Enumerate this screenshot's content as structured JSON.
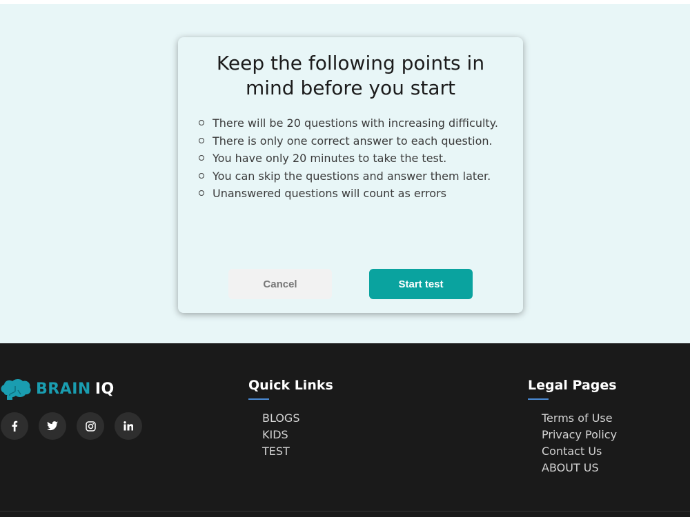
{
  "modal": {
    "title": "Keep the following points in mind before you start",
    "points": [
      "There will be 20 questions with increasing difficulty.",
      "There is only one correct answer to each question.",
      "You have only 20 minutes to take the test.",
      "You can skip the questions and answer them later.",
      "Unanswered questions will count as errors"
    ],
    "cancel_label": "Cancel",
    "start_label": "Start test"
  },
  "footer": {
    "logo_brain": "BRAIN",
    "logo_iq": "IQ",
    "socials": [
      {
        "icon": "facebook-icon",
        "glyph": "f"
      },
      {
        "icon": "twitter-icon",
        "glyph": "t"
      },
      {
        "icon": "instagram-icon",
        "glyph": "ig"
      },
      {
        "icon": "linkedin-icon",
        "glyph": "in"
      }
    ],
    "quick_links": {
      "title": "Quick Links",
      "items": [
        "BLOGS",
        "KIDS",
        "TEST"
      ]
    },
    "legal_pages": {
      "title": "Legal Pages",
      "items": [
        "Terms of Use",
        "Privacy Policy",
        "Contact Us",
        "ABOUT US"
      ]
    }
  },
  "colors": {
    "accent": "#0aa39f",
    "brand": "#1a9db0",
    "background": "#e8f6f7",
    "footer": "#1a1a1a"
  }
}
